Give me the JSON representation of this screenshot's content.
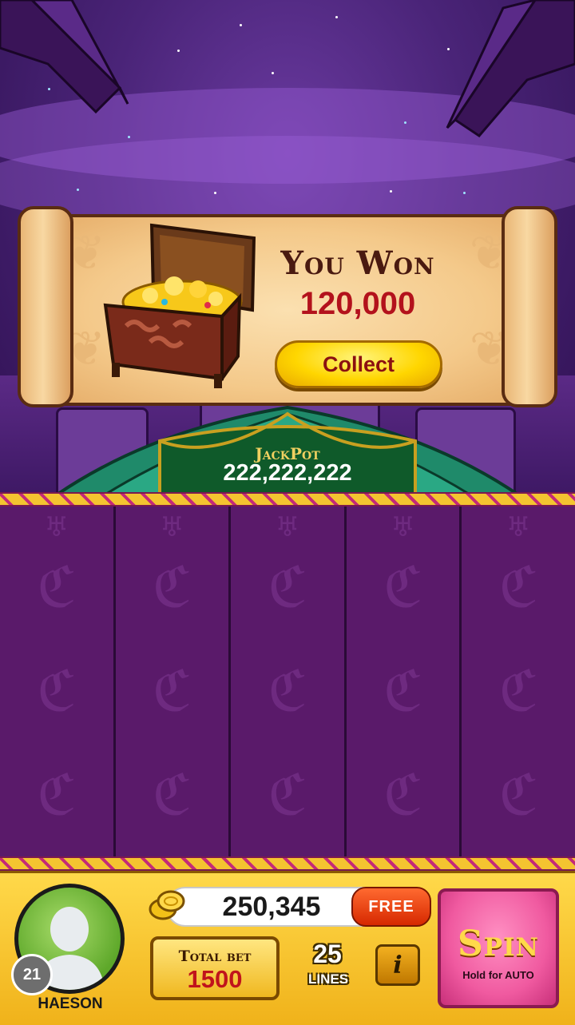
{
  "win_popup": {
    "title": "You Won",
    "amount": "120,000",
    "collect_label": "Collect"
  },
  "jackpot": {
    "label": "JackPot",
    "value": "222,222,222"
  },
  "player": {
    "level": "21",
    "name": "HAESON"
  },
  "balance": {
    "value": "250,345",
    "free_label": "FREE"
  },
  "bet": {
    "total_bet_label": "Total bet",
    "total_bet_value": "1500",
    "lines_value": "25",
    "lines_label": "LINES",
    "info_label": "i"
  },
  "spin": {
    "label": "Spin",
    "sub_label": "Hold for AUTO"
  },
  "colors": {
    "win_amount": "#b3121c",
    "collect_button": "#ffd600",
    "spin_button": "#f05aa0",
    "free_button": "#d62800"
  },
  "icons": [
    "treasure-chest-icon",
    "gold-coins-icon",
    "avatar-silhouette-icon",
    "info-icon"
  ]
}
